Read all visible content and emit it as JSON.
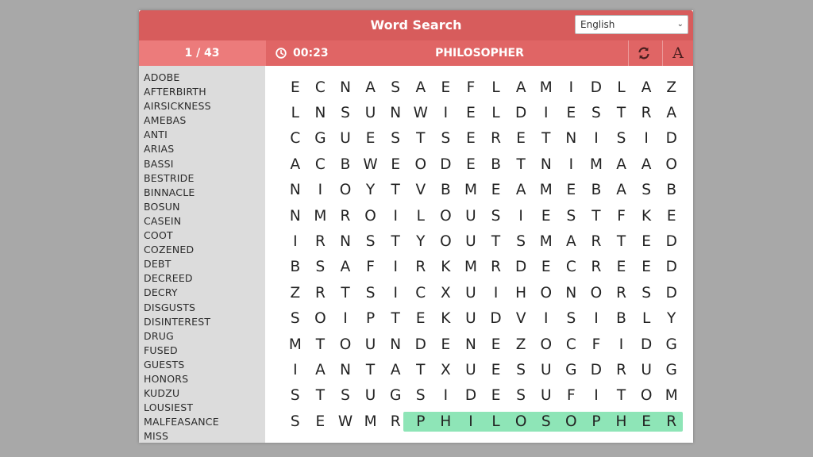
{
  "header": {
    "title": "Word Search"
  },
  "language": {
    "selected": "English"
  },
  "status": {
    "counter": "1 / 43",
    "timer": "00:23",
    "current_word": "PHILOSOPHER"
  },
  "icons": {
    "timer": "clock-icon",
    "refresh": "refresh-icon",
    "font": "font-icon"
  },
  "colors": {
    "header": "#d75c5c",
    "toolbar": "#ec7b7b",
    "highlight": "#8ee5b7"
  },
  "words": [
    "ADOBE",
    "AFTERBIRTH",
    "AIRSICKNESS",
    "AMEBAS",
    "ANTI",
    "ARIAS",
    "BASSI",
    "BESTRIDE",
    "BINNACLE",
    "BOSUN",
    "CASEIN",
    "COOT",
    "COZENED",
    "DEBT",
    "DECREED",
    "DECRY",
    "DISGUSTS",
    "DISINTEREST",
    "DRUG",
    "FUSED",
    "GUESTS",
    "HONORS",
    "KUDZU",
    "LOUSIEST",
    "MALFEASANCE",
    "MISS"
  ],
  "grid": [
    "ECNASAEFLAMIDLAZ",
    "LNSUNWIELDIESTRA",
    "CGUESTSERETNISID",
    "ACBWEODEBTNIMAAO",
    "NIOYTVBMEAMEBASB",
    "NMROILOUSIESTFKE",
    "IRNSTYOUTSMARTED",
    "BSAFIRKMRDECREED",
    "ZRTSICXUIHONORSD",
    "SOIPTEKUDVISIBLY",
    "MTOUNDENEZOCFIDG",
    "IANTATXUESUGDRUG",
    "STSUGSIDESUFITOM",
    "SEWMRPHILOSOPHER"
  ],
  "found": [
    {
      "word": "PHILOSOPHER",
      "row": 13,
      "col_start": 5,
      "col_end": 15
    }
  ]
}
